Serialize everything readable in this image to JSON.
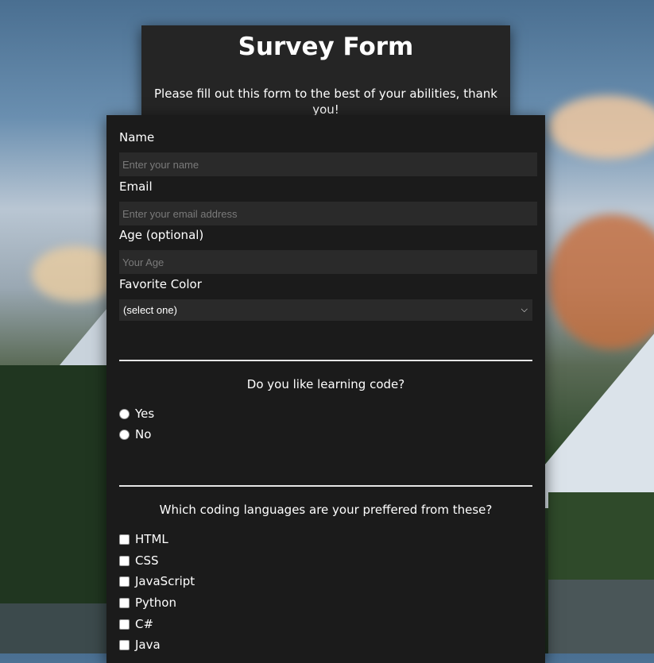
{
  "header": {
    "title": "Survey Form",
    "description": "Please fill out this form to the best of your abilities, thank you!"
  },
  "form": {
    "name": {
      "label": "Name",
      "placeholder": "Enter your name",
      "value": ""
    },
    "email": {
      "label": "Email",
      "placeholder": "Enter your email address",
      "value": ""
    },
    "age": {
      "label": "Age (optional)",
      "placeholder": "Your Age",
      "value": ""
    },
    "favorite_color": {
      "label": "Favorite Color",
      "selected": "(select one)"
    },
    "learning_question": {
      "prompt": "Do you like learning code?",
      "options": [
        "Yes",
        "No"
      ],
      "selected": null
    },
    "languages_question": {
      "prompt": "Which coding languages are your preffered from these?",
      "options": [
        "HTML",
        "CSS",
        "JavaScript",
        "Python",
        "C#",
        "Java"
      ],
      "checked": []
    }
  },
  "colors": {
    "card_background": "#1b1b1b",
    "header_background": "#252525",
    "input_background": "#2a2a2a",
    "text": "#ffffff",
    "placeholder": "#7a7a7a"
  },
  "icons": {
    "select_chevron": "chevron-down-icon",
    "radio": "radio-unchecked-icon",
    "checkbox": "checkbox-unchecked-icon"
  }
}
